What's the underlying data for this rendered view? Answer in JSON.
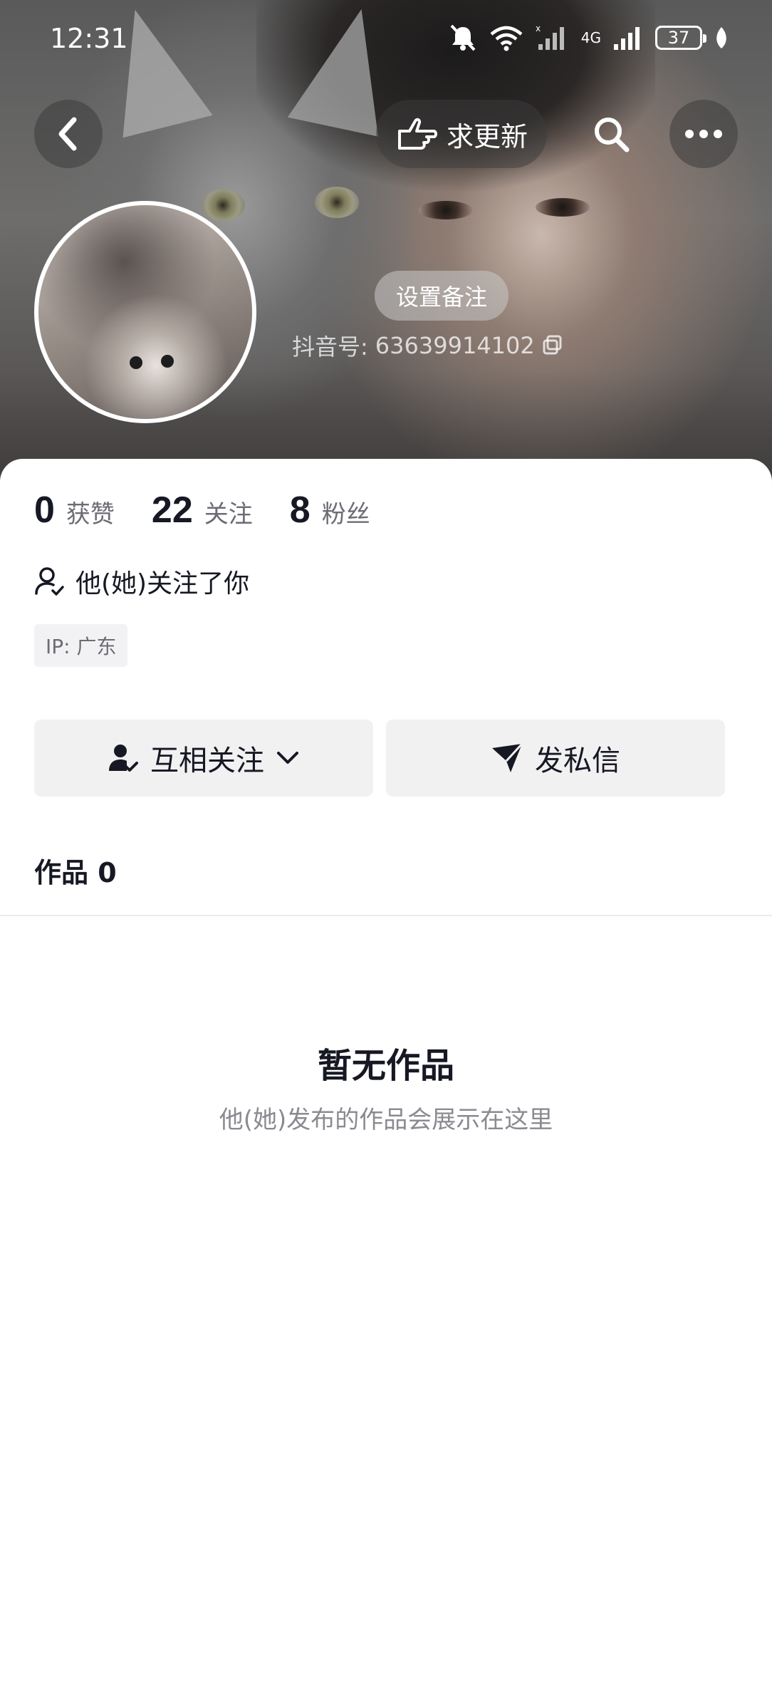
{
  "status_bar": {
    "time": "12:31",
    "battery": "37",
    "network": "4G"
  },
  "header": {
    "request_update_label": "求更新"
  },
  "profile": {
    "remark_button": "设置备注",
    "douyin_id_label": "抖音号:",
    "douyin_id": "63639914102",
    "stats": [
      {
        "value": "0",
        "label": "获赞"
      },
      {
        "value": "22",
        "label": "关注"
      },
      {
        "value": "8",
        "label": "粉丝"
      }
    ],
    "follow_note": "他(她)关注了你",
    "ip_location": "IP: 广东"
  },
  "actions": {
    "mutual_follow": "互相关注",
    "message": "发私信"
  },
  "works": {
    "tab_label": "作品 0",
    "empty_title": "暂无作品",
    "empty_subtitle": "他(她)发布的作品会展示在这里"
  }
}
